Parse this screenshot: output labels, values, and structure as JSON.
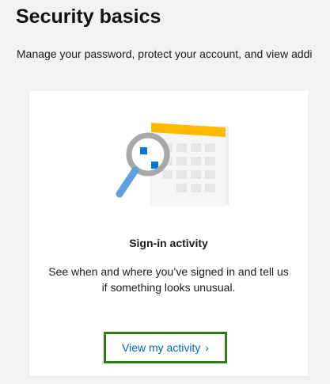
{
  "header": {
    "title": "Security basics",
    "subtitle": "Manage your password, protect your account, and view addi"
  },
  "card": {
    "illustration": "calendar-magnifier-illustration",
    "title": "Sign-in activity",
    "description": "See when and where you’ve signed in and tell us if something looks unusual.",
    "action_label": "View my activity",
    "action_icon": "chevron-right-icon",
    "action_glyph": "›"
  },
  "colors": {
    "link": "#0067b8",
    "highlight_border": "#2e7d16",
    "calendar_header": "#ffb900",
    "magnifier_handle": "#5ea0e0",
    "magnifier_ring": "#a8a8a8",
    "accent_square": "#0078d4"
  }
}
